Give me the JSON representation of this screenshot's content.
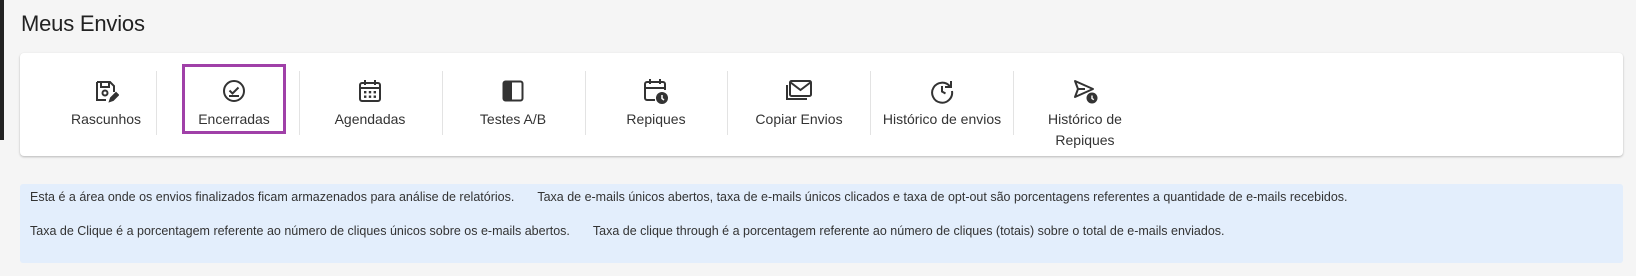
{
  "page": {
    "title": "Meus Envios"
  },
  "tabs": [
    {
      "label": "Rascunhos",
      "icon": "draft-save-edit-icon"
    },
    {
      "label": "Encerradas",
      "icon": "check-circle-icon",
      "selected": true
    },
    {
      "label": "Agendadas",
      "icon": "calendar-icon"
    },
    {
      "label": "Testes A/B",
      "icon": "split-square-icon"
    },
    {
      "label": "Repiques",
      "icon": "calendar-clock-icon"
    },
    {
      "label": "Copiar Envios",
      "icon": "mail-copy-icon"
    },
    {
      "label": "Histórico de envios",
      "icon": "history-icon"
    },
    {
      "label": "Histórico de\nRepiques",
      "icon": "send-clock-icon"
    }
  ],
  "info": {
    "line1a": "Esta é a área onde os envios finalizados ficam armazenados para análise de relatórios.",
    "line1b": "Taxa de e-mails únicos abertos, taxa de e-mails únicos clicados e taxa de opt-out são porcentagens referentes a quantidade de e-mails recebidos.",
    "line2a": "Taxa de Clique é a porcentagem referente ao número de cliques únicos sobre os e-mails abertos.",
    "line2b": "Taxa de clique through é a porcentagem referente ao número de cliques (totais) sobre o total de e-mails enviados."
  },
  "colors": {
    "selected_outline": "#a040a8",
    "info_background": "#e3eefc"
  }
}
